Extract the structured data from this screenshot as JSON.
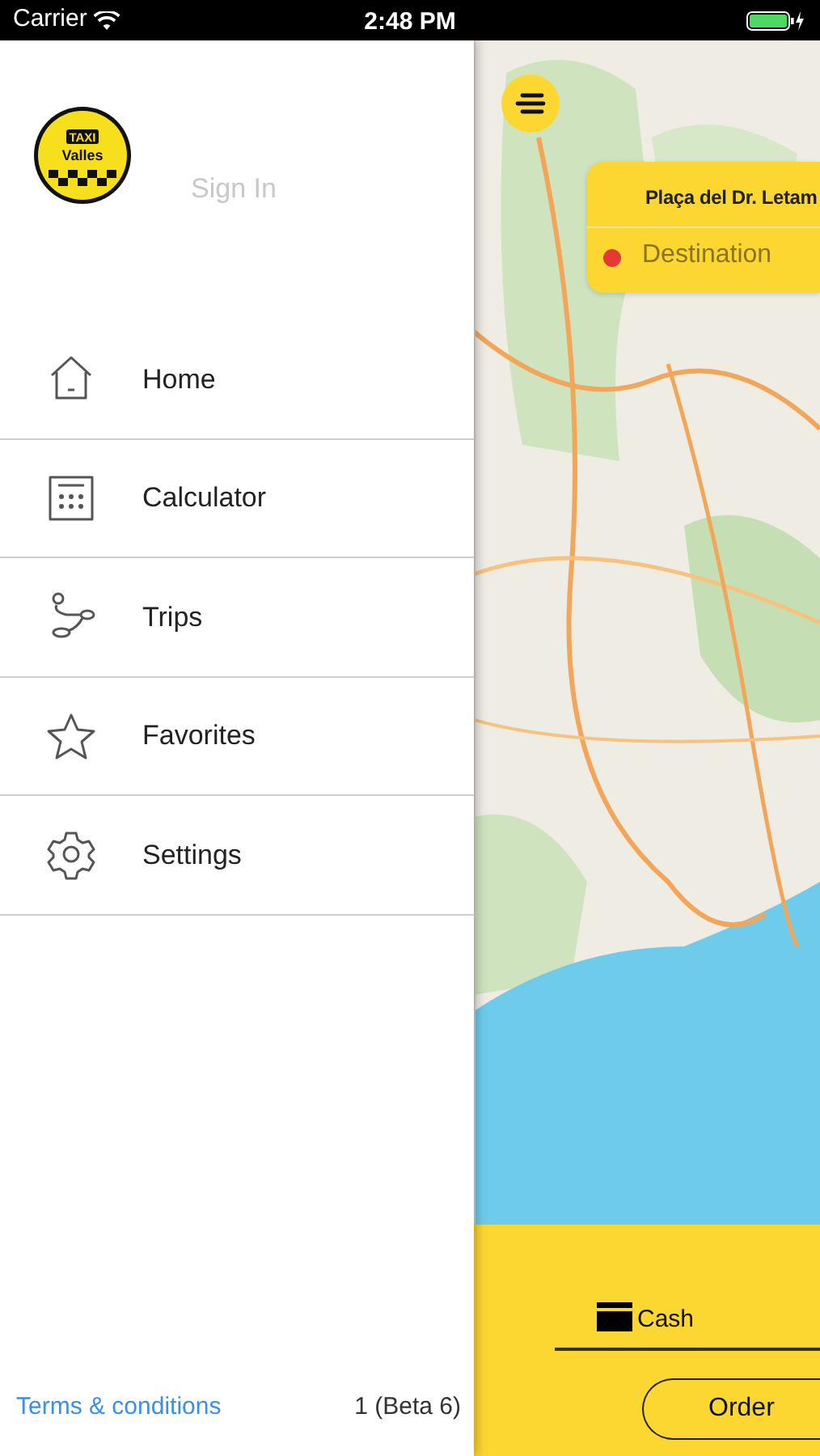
{
  "status_bar": {
    "carrier": "Carrier",
    "time": "2:48 PM"
  },
  "drawer": {
    "logo": {
      "top": "TAXI",
      "bottom": "Valles"
    },
    "sign_in": "Sign In",
    "menu": [
      {
        "label": "Home",
        "kind": "home"
      },
      {
        "label": "Calculator",
        "kind": "calculator"
      },
      {
        "label": "Trips",
        "kind": "trips"
      },
      {
        "label": "Favorites",
        "kind": "star"
      },
      {
        "label": "Settings",
        "kind": "gear"
      }
    ],
    "terms_link": "Terms & conditions",
    "version": "1 (Beta 6)"
  },
  "map": {
    "kind": "picture",
    "route_card": {
      "origin": "Plaça del Dr. Letam",
      "destination": {
        "placeholder": "Destination"
      }
    },
    "payment": {
      "label": "Cash"
    },
    "order_button": "Order"
  }
}
